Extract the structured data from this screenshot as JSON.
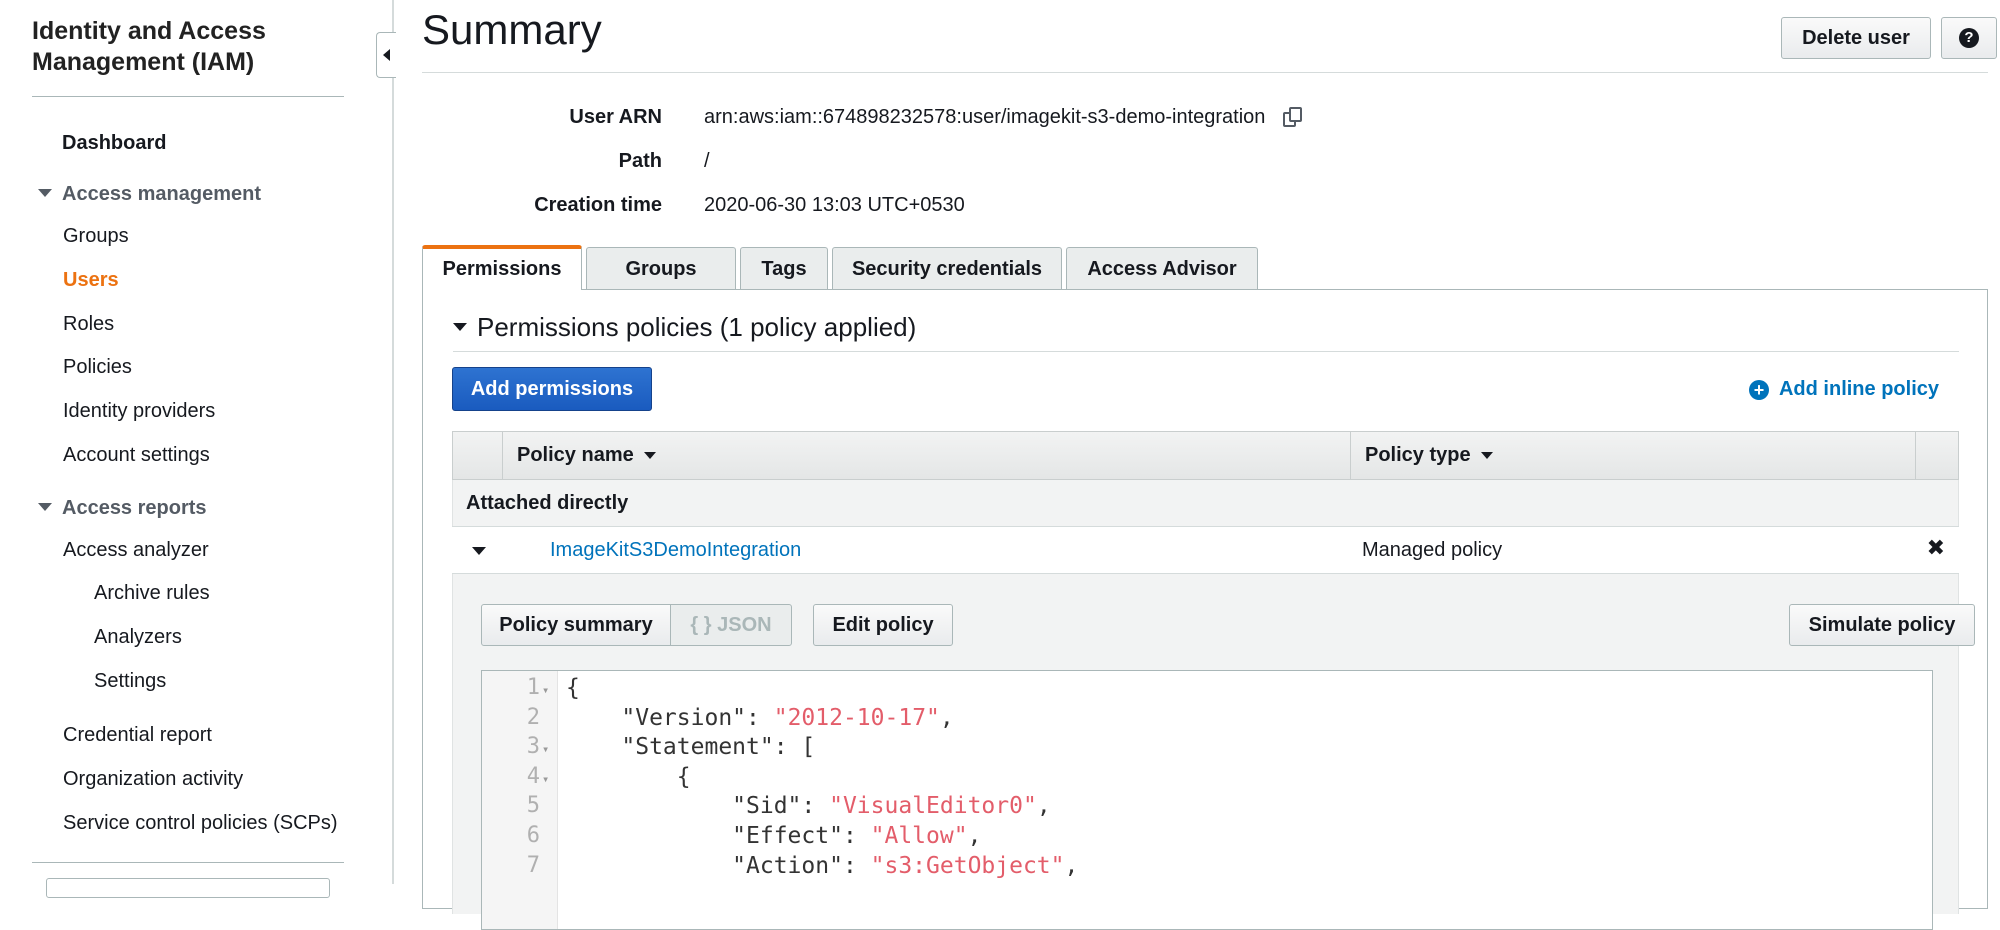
{
  "sidebar": {
    "title": "Identity and Access Management (IAM)",
    "dashboard": "Dashboard",
    "access_management": {
      "label": "Access management",
      "items": [
        "Groups",
        "Users",
        "Roles",
        "Policies",
        "Identity providers",
        "Account settings"
      ],
      "active": "Users"
    },
    "access_reports": {
      "label": "Access reports",
      "analyzer": "Access analyzer",
      "sub_items": [
        "Archive rules",
        "Analyzers",
        "Settings"
      ],
      "items": [
        "Credential report",
        "Organization activity",
        "Service control policies (SCPs)"
      ]
    }
  },
  "header": {
    "title": "Summary",
    "delete_label": "Delete user",
    "help_label": "?"
  },
  "meta": {
    "arn_label": "User ARN",
    "arn_value": "arn:aws:iam::674898232578:user/imagekit-s3-demo-integration",
    "path_label": "Path",
    "path_value": "/",
    "creation_label": "Creation time",
    "creation_value": "2020-06-30 13:03 UTC+0530"
  },
  "tabs": [
    "Permissions",
    "Groups",
    "Tags",
    "Security credentials",
    "Access Advisor"
  ],
  "permissions": {
    "section_title": "Permissions policies (1 policy applied)",
    "add_permissions": "Add permissions",
    "add_inline": "Add inline policy",
    "col_policy_name": "Policy name",
    "col_policy_type": "Policy type",
    "group_label": "Attached directly",
    "policy_name": "ImageKitS3DemoIntegration",
    "policy_type": "Managed policy",
    "remove_glyph": "✖",
    "policy_summary": "Policy summary",
    "json_label": "{ } JSON",
    "edit_policy": "Edit policy",
    "simulate_policy": "Simulate policy"
  },
  "editor": {
    "line_numbers": [
      "1",
      "2",
      "3",
      "4",
      "5",
      "6",
      "7"
    ],
    "lines": [
      {
        "plain": "{",
        "str": "",
        "tail": ""
      },
      {
        "plain": "    \"Version\": ",
        "str": "\"2012-10-17\"",
        "tail": ","
      },
      {
        "plain": "    \"Statement\": [",
        "str": "",
        "tail": ""
      },
      {
        "plain": "        {",
        "str": "",
        "tail": ""
      },
      {
        "plain": "            \"Sid\": ",
        "str": "\"VisualEditor0\"",
        "tail": ","
      },
      {
        "plain": "            \"Effect\": ",
        "str": "\"Allow\"",
        "tail": ","
      },
      {
        "plain": "            \"Action\": ",
        "str": "\"s3:GetObject\"",
        "tail": ","
      }
    ]
  },
  "colors": {
    "accent": "#ec7211",
    "link": "#0073bb",
    "primary_button": "#1a5bbf",
    "json_string": "#e35d6a"
  }
}
